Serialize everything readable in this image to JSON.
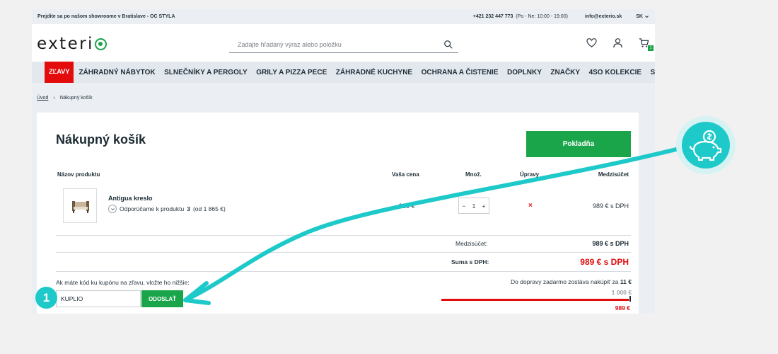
{
  "topbar": {
    "promo": "Prejdite sa po našom showroome v Bratislave - OC STYLA",
    "phone": "+421 232 447 773",
    "hours": "(Po - Ne: 10:00 - 19:00)",
    "email": "info@exterio.sk",
    "language": "SK"
  },
  "header": {
    "logo_text": "exteri",
    "search_placeholder": "Zadajte hľadaný výraz alebo položku",
    "cart_count": "1"
  },
  "nav": {
    "items": [
      "ZĽAVY",
      "ZÁHRADNÝ NÁBYTOK",
      "SLNEČNÍKY A PERGOLY",
      "GRILY A PIZZA PECE",
      "ZÁHRADNÉ KUCHYNE",
      "OCHRANA A ČISTENIE",
      "DOPLNKY",
      "ZNAČKY",
      "4SO KOLEKCIE",
      "SHOWROOM"
    ]
  },
  "breadcrumb": {
    "home": "Úvod",
    "separator": "›",
    "current": "Nákupný košík"
  },
  "cart": {
    "title": "Nákupný košík",
    "checkout_label": "Pokladňa",
    "columns": {
      "product": "Názov produktu",
      "price": "Vaša cena",
      "qty": "Množ.",
      "edit": "Úpravy",
      "subtotal": "Medzisúčet"
    },
    "item": {
      "name": "Antigua kreslo",
      "recommend_prefix": "Odporúčame k produktu",
      "recommend_count": "3",
      "recommend_suffix": "(od 1 865 €)",
      "price": "989 €",
      "qty": "1",
      "qty_minus": "−",
      "qty_plus": "+",
      "remove": "×",
      "subtotal": "989 € s DPH"
    },
    "summary": {
      "subtotal_label": "Medzisúčet:",
      "subtotal_value": "989 € s DPH",
      "total_label": "Suma s DPH:",
      "total_value": "989 € s DPH"
    },
    "coupon": {
      "label": "Ak máte kód ku kupónu na zľavu, vložte ho nižšie:",
      "value": "KUPLIO",
      "button": "ODOSLAŤ"
    },
    "free_shipping": {
      "text": "Do dopravy zadarmo zostáva nakúpiť za",
      "remaining": "11 €",
      "threshold": "1 000 €",
      "current": "989 €",
      "progress_fraction": 0.989
    }
  },
  "annotations": {
    "step_number": "1"
  },
  "colors": {
    "green": "#1aa54b",
    "red": "#e30b0b",
    "teal": "#1ec9c9"
  },
  "icons": [
    "search-icon",
    "heart-icon",
    "user-icon",
    "cart-icon",
    "piggy-bank-icon",
    "chevron-down-icon"
  ]
}
